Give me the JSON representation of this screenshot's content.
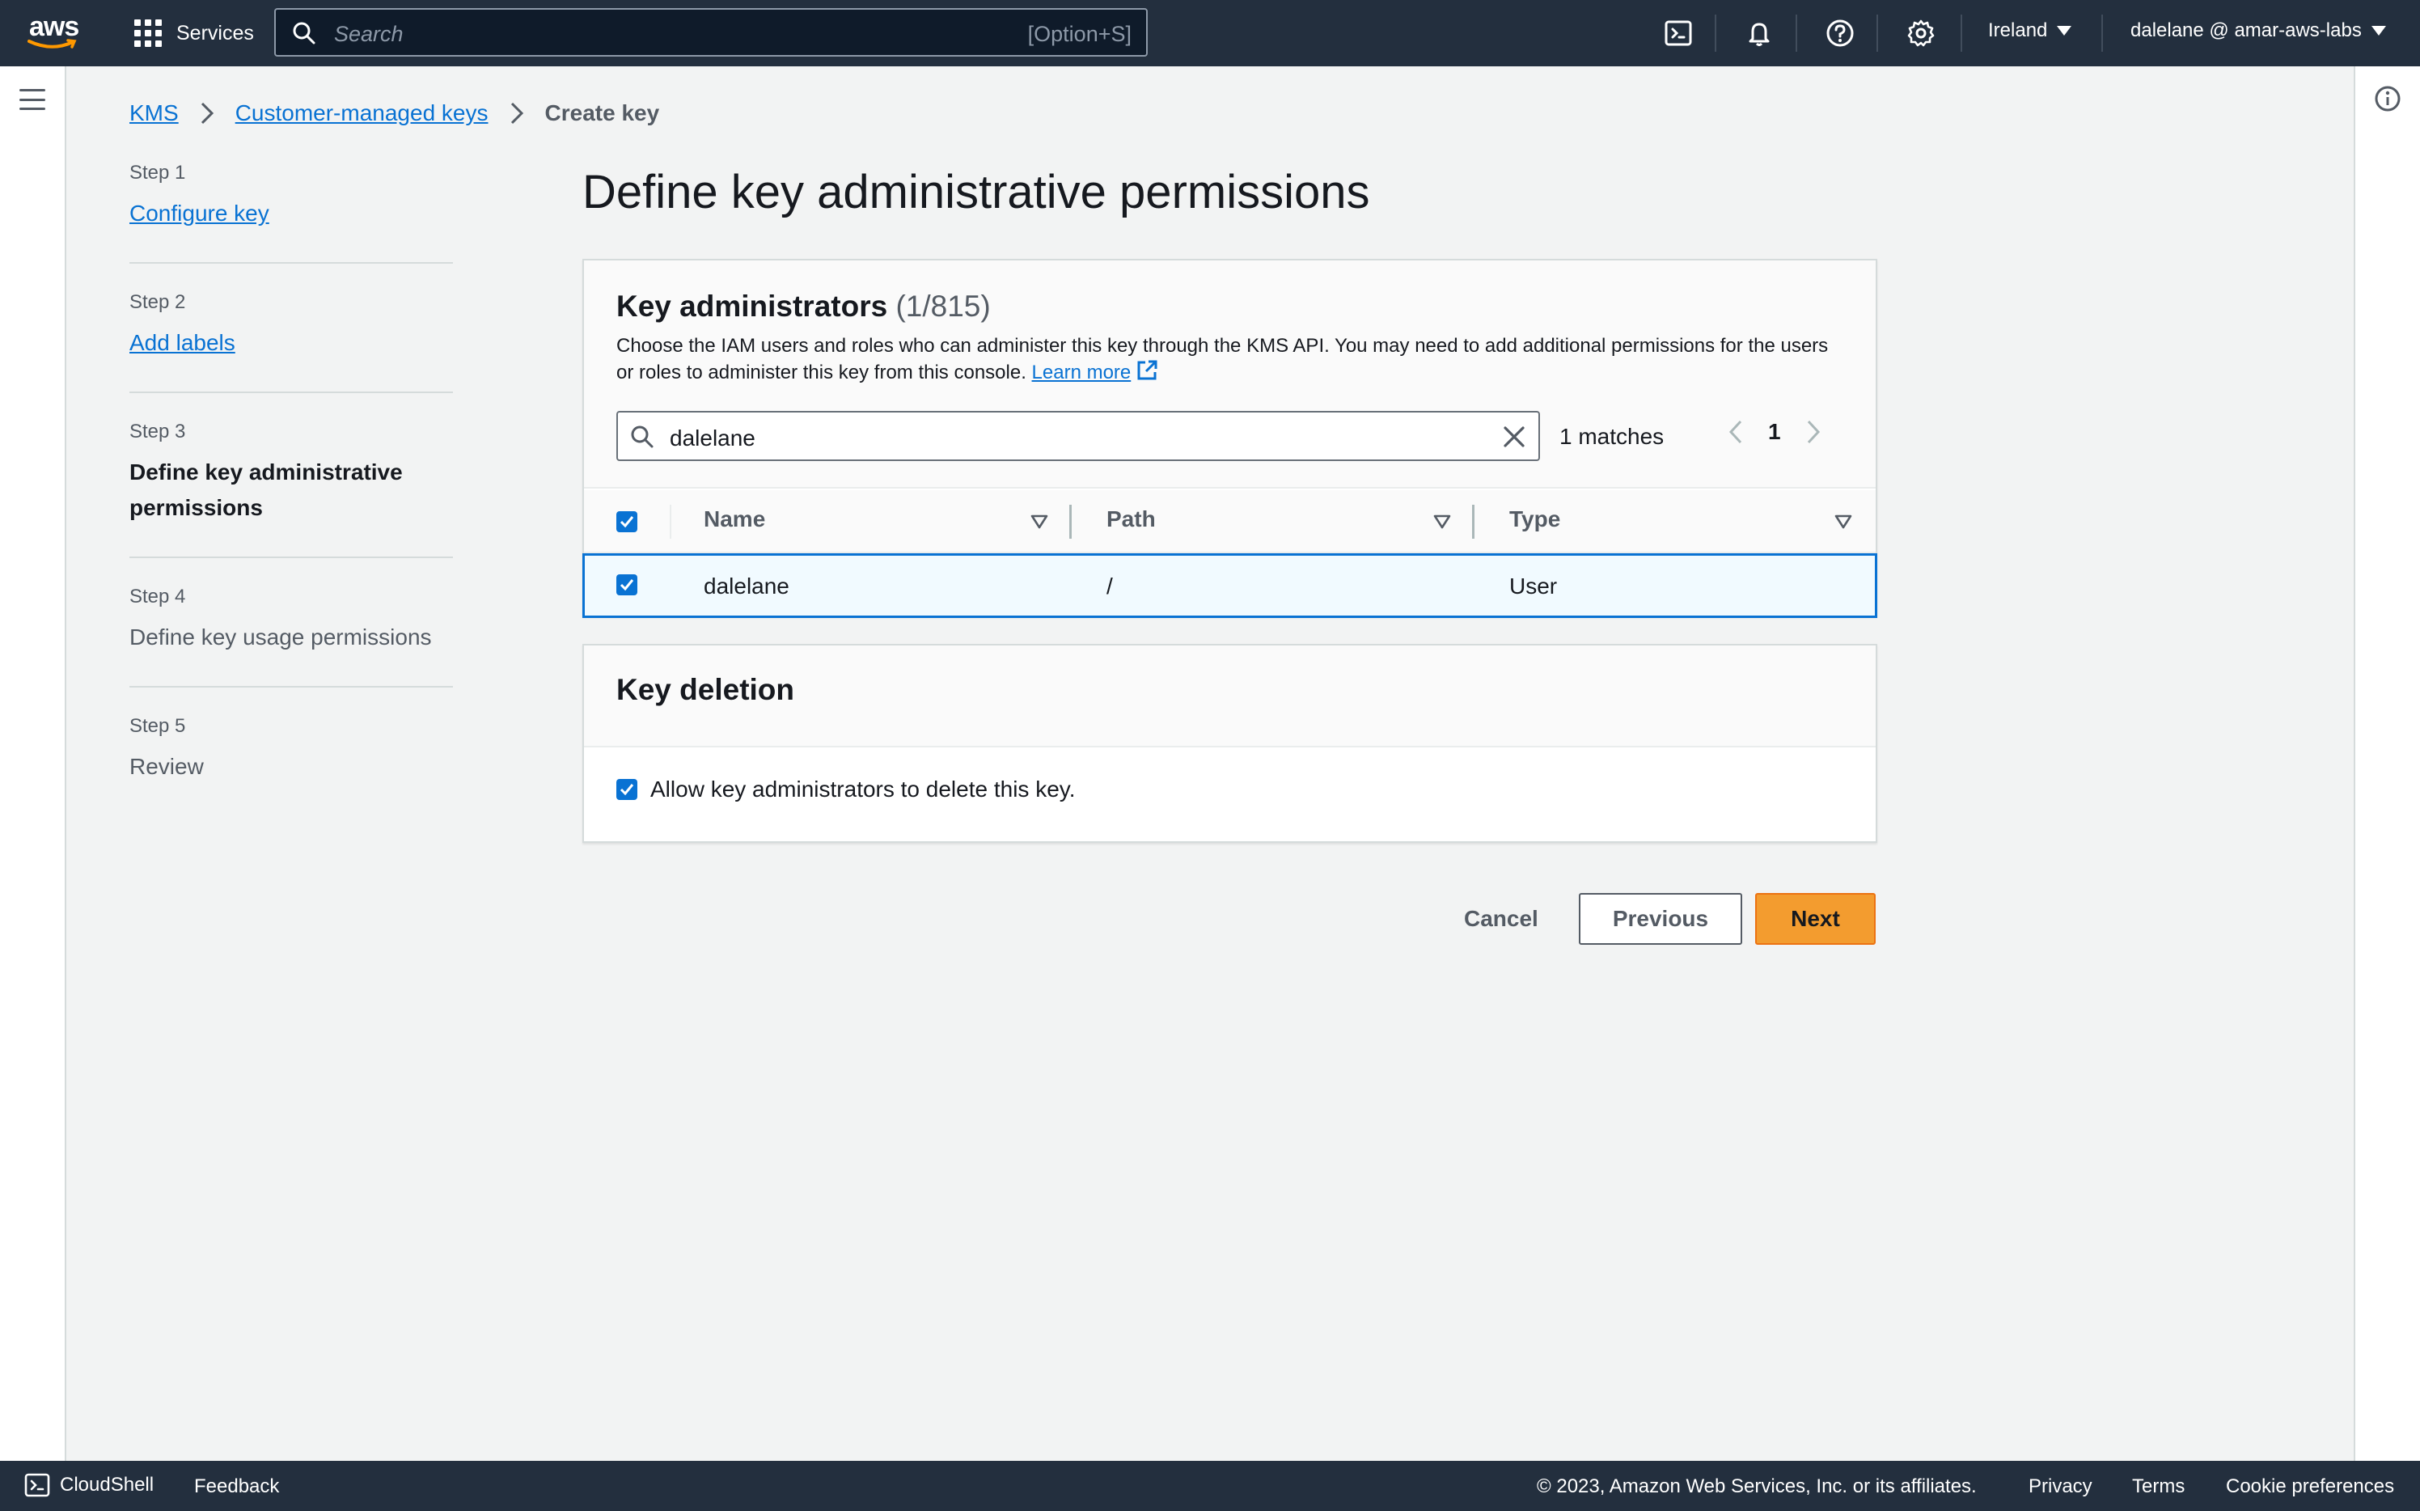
{
  "topnav": {
    "logo_text": "aws",
    "services_label": "Services",
    "search_placeholder": "Search",
    "search_shortcut": "[Option+S]",
    "region": "Ireland",
    "account": "dalelane @ amar-aws-labs",
    "icons": [
      "cloudshell-icon",
      "bell-icon",
      "help-icon",
      "gear-icon"
    ]
  },
  "breadcrumb": {
    "items": [
      "KMS",
      "Customer-managed keys"
    ],
    "current": "Create key"
  },
  "steps": [
    {
      "num": "Step 1",
      "label": "Configure key",
      "state": "link"
    },
    {
      "num": "Step 2",
      "label": "Add labels",
      "state": "link"
    },
    {
      "num": "Step 3",
      "label": "Define key administrative permissions",
      "state": "active"
    },
    {
      "num": "Step 4",
      "label": "Define key usage permissions",
      "state": "disabled"
    },
    {
      "num": "Step 5",
      "label": "Review",
      "state": "disabled"
    }
  ],
  "page_title": "Define key administrative permissions",
  "key_admins": {
    "title": "Key administrators",
    "count": "(1/815)",
    "description": "Choose the IAM users and roles who can administer this key through the KMS API. You may need to add additional permissions for the users or roles to administer this key from this console.",
    "learn_more": "Learn more",
    "filter_value": "dalelane",
    "matches": "1 matches",
    "page": "1",
    "columns": [
      "Name",
      "Path",
      "Type"
    ],
    "rows": [
      {
        "selected": true,
        "name": "dalelane",
        "path": "/",
        "type": "User"
      }
    ]
  },
  "key_deletion": {
    "title": "Key deletion",
    "checkbox_label": "Allow key administrators to delete this key.",
    "checked": true
  },
  "actions": {
    "cancel": "Cancel",
    "previous": "Previous",
    "next": "Next"
  },
  "footer": {
    "cloudshell": "CloudShell",
    "feedback": "Feedback",
    "copyright": "© 2023, Amazon Web Services, Inc. or its affiliates.",
    "privacy": "Privacy",
    "terms": "Terms",
    "cookies": "Cookie preferences"
  },
  "colors": {
    "nav_bg": "#232f3e",
    "link": "#0972d3",
    "primary_button": "#f39c2f",
    "selected_row_bg": "#f1faff"
  }
}
